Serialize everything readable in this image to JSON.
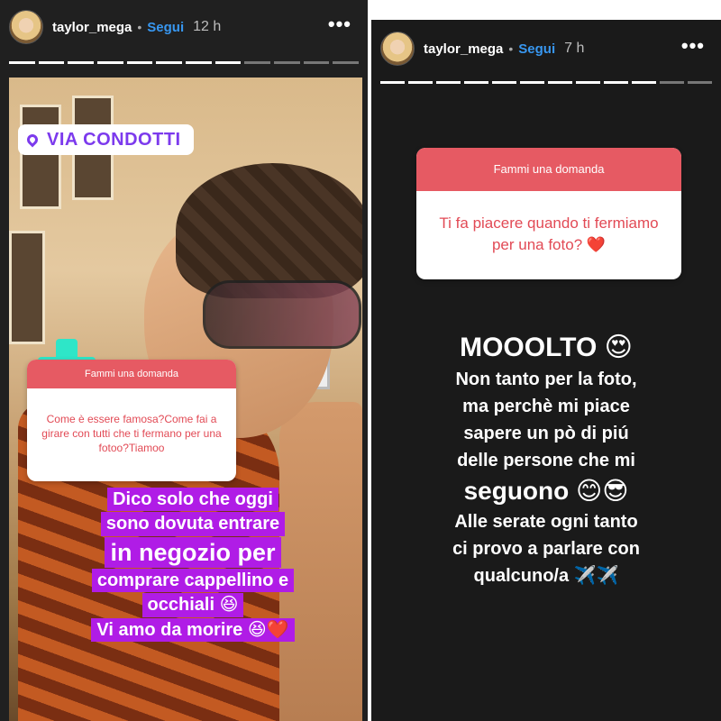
{
  "left_story": {
    "username": "taylor_mega",
    "follow_label": "Segui",
    "time": "12 h",
    "more_label": "•••",
    "location_label": "VIA CONDOTTI",
    "question": {
      "header": "Fammi una domanda",
      "text": "Come è essere famosa?Come fai a girare con tutti che ti fermano per una fotoo?Tiamoo"
    },
    "caption_lines": [
      "Dico solo che oggi",
      "sono dovuta entrare",
      "in negozio per",
      "comprare cappellino e",
      "occhiali 😆",
      "Vi amo da morire 😆❤️"
    ]
  },
  "right_story": {
    "username": "taylor_mega",
    "follow_label": "Segui",
    "time": "7 h",
    "more_label": "•••",
    "question": {
      "header": "Fammi una domanda",
      "text": "Ti fa piacere quando ti fermiamo per una foto? ❤️"
    },
    "answer_lines": [
      "MOOOLTO 😍",
      "Non tanto per la foto,",
      "ma perchè mi piace",
      "sapere un pò di piú",
      "delle persone che mi",
      "seguono 😊😎",
      "Alle serate ogni tanto",
      "ci provo a parlare con",
      "qualcuno/a ✈️✈️"
    ]
  },
  "colors": {
    "follow": "#3897f0",
    "question_header": "#e65a63",
    "question_text": "#e24a55",
    "caption_bg": "#b01ce6",
    "location_text": "#7c3aed"
  }
}
